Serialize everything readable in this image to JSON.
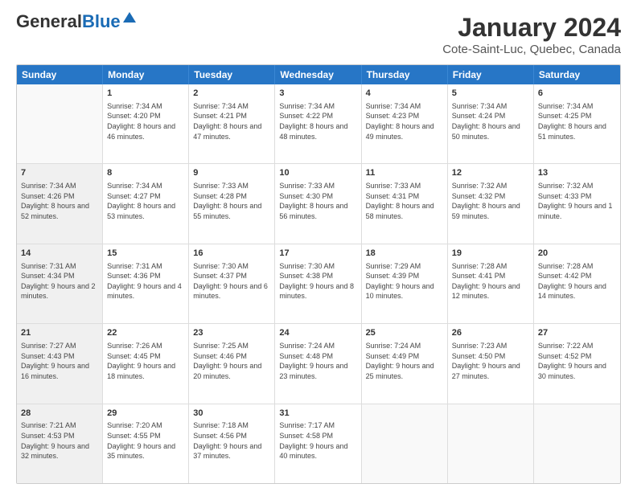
{
  "header": {
    "logo_general": "General",
    "logo_blue": "Blue",
    "month": "January 2024",
    "location": "Cote-Saint-Luc, Quebec, Canada"
  },
  "days_of_week": [
    "Sunday",
    "Monday",
    "Tuesday",
    "Wednesday",
    "Thursday",
    "Friday",
    "Saturday"
  ],
  "weeks": [
    [
      {
        "num": "",
        "sunrise": "",
        "sunset": "",
        "daylight": "",
        "empty": true
      },
      {
        "num": "1",
        "sunrise": "Sunrise: 7:34 AM",
        "sunset": "Sunset: 4:20 PM",
        "daylight": "Daylight: 8 hours and 46 minutes."
      },
      {
        "num": "2",
        "sunrise": "Sunrise: 7:34 AM",
        "sunset": "Sunset: 4:21 PM",
        "daylight": "Daylight: 8 hours and 47 minutes."
      },
      {
        "num": "3",
        "sunrise": "Sunrise: 7:34 AM",
        "sunset": "Sunset: 4:22 PM",
        "daylight": "Daylight: 8 hours and 48 minutes."
      },
      {
        "num": "4",
        "sunrise": "Sunrise: 7:34 AM",
        "sunset": "Sunset: 4:23 PM",
        "daylight": "Daylight: 8 hours and 49 minutes."
      },
      {
        "num": "5",
        "sunrise": "Sunrise: 7:34 AM",
        "sunset": "Sunset: 4:24 PM",
        "daylight": "Daylight: 8 hours and 50 minutes."
      },
      {
        "num": "6",
        "sunrise": "Sunrise: 7:34 AM",
        "sunset": "Sunset: 4:25 PM",
        "daylight": "Daylight: 8 hours and 51 minutes."
      }
    ],
    [
      {
        "num": "7",
        "sunrise": "Sunrise: 7:34 AM",
        "sunset": "Sunset: 4:26 PM",
        "daylight": "Daylight: 8 hours and 52 minutes.",
        "shaded": true
      },
      {
        "num": "8",
        "sunrise": "Sunrise: 7:34 AM",
        "sunset": "Sunset: 4:27 PM",
        "daylight": "Daylight: 8 hours and 53 minutes."
      },
      {
        "num": "9",
        "sunrise": "Sunrise: 7:33 AM",
        "sunset": "Sunset: 4:28 PM",
        "daylight": "Daylight: 8 hours and 55 minutes."
      },
      {
        "num": "10",
        "sunrise": "Sunrise: 7:33 AM",
        "sunset": "Sunset: 4:30 PM",
        "daylight": "Daylight: 8 hours and 56 minutes."
      },
      {
        "num": "11",
        "sunrise": "Sunrise: 7:33 AM",
        "sunset": "Sunset: 4:31 PM",
        "daylight": "Daylight: 8 hours and 58 minutes."
      },
      {
        "num": "12",
        "sunrise": "Sunrise: 7:32 AM",
        "sunset": "Sunset: 4:32 PM",
        "daylight": "Daylight: 8 hours and 59 minutes."
      },
      {
        "num": "13",
        "sunrise": "Sunrise: 7:32 AM",
        "sunset": "Sunset: 4:33 PM",
        "daylight": "Daylight: 9 hours and 1 minute."
      }
    ],
    [
      {
        "num": "14",
        "sunrise": "Sunrise: 7:31 AM",
        "sunset": "Sunset: 4:34 PM",
        "daylight": "Daylight: 9 hours and 2 minutes.",
        "shaded": true
      },
      {
        "num": "15",
        "sunrise": "Sunrise: 7:31 AM",
        "sunset": "Sunset: 4:36 PM",
        "daylight": "Daylight: 9 hours and 4 minutes."
      },
      {
        "num": "16",
        "sunrise": "Sunrise: 7:30 AM",
        "sunset": "Sunset: 4:37 PM",
        "daylight": "Daylight: 9 hours and 6 minutes."
      },
      {
        "num": "17",
        "sunrise": "Sunrise: 7:30 AM",
        "sunset": "Sunset: 4:38 PM",
        "daylight": "Daylight: 9 hours and 8 minutes."
      },
      {
        "num": "18",
        "sunrise": "Sunrise: 7:29 AM",
        "sunset": "Sunset: 4:39 PM",
        "daylight": "Daylight: 9 hours and 10 minutes."
      },
      {
        "num": "19",
        "sunrise": "Sunrise: 7:28 AM",
        "sunset": "Sunset: 4:41 PM",
        "daylight": "Daylight: 9 hours and 12 minutes."
      },
      {
        "num": "20",
        "sunrise": "Sunrise: 7:28 AM",
        "sunset": "Sunset: 4:42 PM",
        "daylight": "Daylight: 9 hours and 14 minutes."
      }
    ],
    [
      {
        "num": "21",
        "sunrise": "Sunrise: 7:27 AM",
        "sunset": "Sunset: 4:43 PM",
        "daylight": "Daylight: 9 hours and 16 minutes.",
        "shaded": true
      },
      {
        "num": "22",
        "sunrise": "Sunrise: 7:26 AM",
        "sunset": "Sunset: 4:45 PM",
        "daylight": "Daylight: 9 hours and 18 minutes."
      },
      {
        "num": "23",
        "sunrise": "Sunrise: 7:25 AM",
        "sunset": "Sunset: 4:46 PM",
        "daylight": "Daylight: 9 hours and 20 minutes."
      },
      {
        "num": "24",
        "sunrise": "Sunrise: 7:24 AM",
        "sunset": "Sunset: 4:48 PM",
        "daylight": "Daylight: 9 hours and 23 minutes."
      },
      {
        "num": "25",
        "sunrise": "Sunrise: 7:24 AM",
        "sunset": "Sunset: 4:49 PM",
        "daylight": "Daylight: 9 hours and 25 minutes."
      },
      {
        "num": "26",
        "sunrise": "Sunrise: 7:23 AM",
        "sunset": "Sunset: 4:50 PM",
        "daylight": "Daylight: 9 hours and 27 minutes."
      },
      {
        "num": "27",
        "sunrise": "Sunrise: 7:22 AM",
        "sunset": "Sunset: 4:52 PM",
        "daylight": "Daylight: 9 hours and 30 minutes."
      }
    ],
    [
      {
        "num": "28",
        "sunrise": "Sunrise: 7:21 AM",
        "sunset": "Sunset: 4:53 PM",
        "daylight": "Daylight: 9 hours and 32 minutes.",
        "shaded": true
      },
      {
        "num": "29",
        "sunrise": "Sunrise: 7:20 AM",
        "sunset": "Sunset: 4:55 PM",
        "daylight": "Daylight: 9 hours and 35 minutes."
      },
      {
        "num": "30",
        "sunrise": "Sunrise: 7:18 AM",
        "sunset": "Sunset: 4:56 PM",
        "daylight": "Daylight: 9 hours and 37 minutes."
      },
      {
        "num": "31",
        "sunrise": "Sunrise: 7:17 AM",
        "sunset": "Sunset: 4:58 PM",
        "daylight": "Daylight: 9 hours and 40 minutes."
      },
      {
        "num": "",
        "sunrise": "",
        "sunset": "",
        "daylight": "",
        "empty": true
      },
      {
        "num": "",
        "sunrise": "",
        "sunset": "",
        "daylight": "",
        "empty": true
      },
      {
        "num": "",
        "sunrise": "",
        "sunset": "",
        "daylight": "",
        "empty": true
      }
    ]
  ]
}
